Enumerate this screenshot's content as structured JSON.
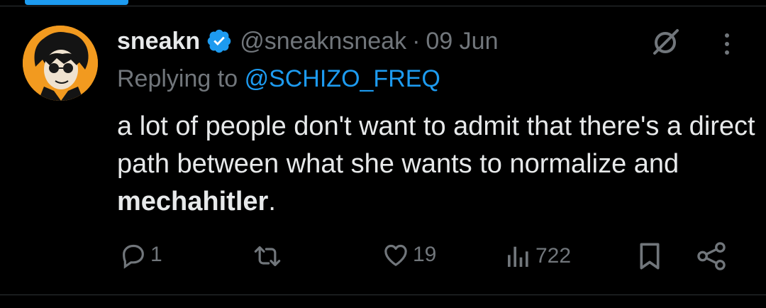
{
  "tweet": {
    "display_name": "sneakn",
    "handle": "@sneaknsneak",
    "separator": "·",
    "date": "09 Jun",
    "reply_prefix": "Replying to",
    "reply_to": "@SCHIZO_FREQ",
    "text_main": "a lot of people don't want to admit that there's a direct path between what she wants to normalize and ",
    "text_bold": "mechahitler",
    "text_end": "."
  },
  "actions": {
    "reply_count": "1",
    "retweet_count": "",
    "like_count": "19",
    "views_count": "722"
  },
  "colors": {
    "background": "#000000",
    "text": "#e7e9ea",
    "muted": "#71767b",
    "accent": "#1d9bf0",
    "avatar_bg": "#f29a1f"
  },
  "icons": {
    "verified": "verified-badge-icon",
    "grok": "grok-icon",
    "more": "more-vertical-icon",
    "reply": "reply-icon",
    "retweet": "retweet-icon",
    "like": "heart-icon",
    "views": "views-icon",
    "bookmark": "bookmark-icon",
    "share": "share-icon"
  }
}
